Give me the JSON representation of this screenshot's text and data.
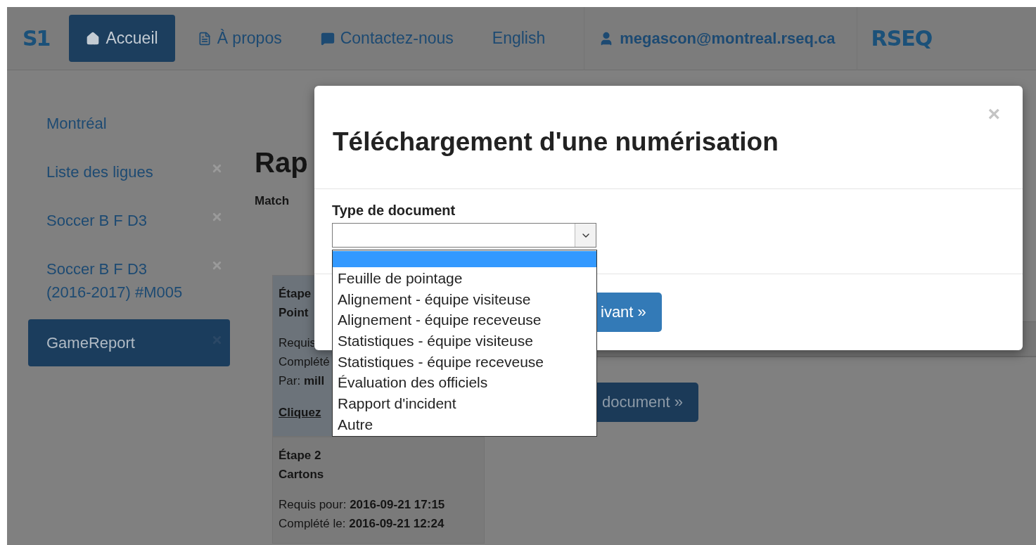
{
  "navbar": {
    "logo": "S1",
    "items": [
      {
        "label": "Accueil",
        "selected": true
      },
      {
        "label": "À propos",
        "selected": false
      },
      {
        "label": "Contactez-nous",
        "selected": false
      },
      {
        "label": "English",
        "selected": false
      }
    ],
    "user": "megascon@montreal.rseq.ca",
    "brand": "RSEQ"
  },
  "sidebar": {
    "items": [
      {
        "label": "Montréal",
        "closable": false,
        "selected": false
      },
      {
        "label": "Liste des ligues",
        "closable": true,
        "selected": false
      },
      {
        "label": "Soccer B F D3",
        "closable": true,
        "selected": false
      },
      {
        "label": "Soccer B F D3 (2016-2017) #M005",
        "closable": true,
        "selected": false
      },
      {
        "label": "GameReport",
        "closable": true,
        "selected": true
      }
    ]
  },
  "main": {
    "title": "Rap",
    "subtitle": "Match",
    "steps": [
      {
        "heading": "Étape",
        "name": "Point",
        "lines": [
          "Requis",
          "Complété",
          "Par: **mill**"
        ],
        "link": "Cliquez"
      },
      {
        "heading": "Étape 2",
        "name": "Cartons",
        "lines": [
          "Requis pour: **2016-09-21 17:15**",
          "Complété le: **2016-09-21 12:24**"
        ]
      }
    ],
    "document_button": "document »"
  },
  "modal": {
    "title": "Téléchargement d'une numérisation",
    "close": "×",
    "field_label": "Type de document",
    "options": [
      {
        "selected": true
      },
      {
        "label": "Feuille de pointage",
        "selected": false
      },
      {
        "label": "Alignement - équipe visiteuse",
        "selected": false
      },
      {
        "label": "Alignement - équipe receveuse",
        "selected": false
      },
      {
        "label": "Statistiques - équipe visiteuse",
        "selected": false
      },
      {
        "label": "Statistiques - équipe receveuse",
        "selected": false
      },
      {
        "label": "Évaluation des officiels",
        "selected": false
      },
      {
        "label": "Rapport d'incident",
        "selected": false
      },
      {
        "label": "Autre",
        "selected": false
      }
    ],
    "next_button": "ivant »"
  }
}
